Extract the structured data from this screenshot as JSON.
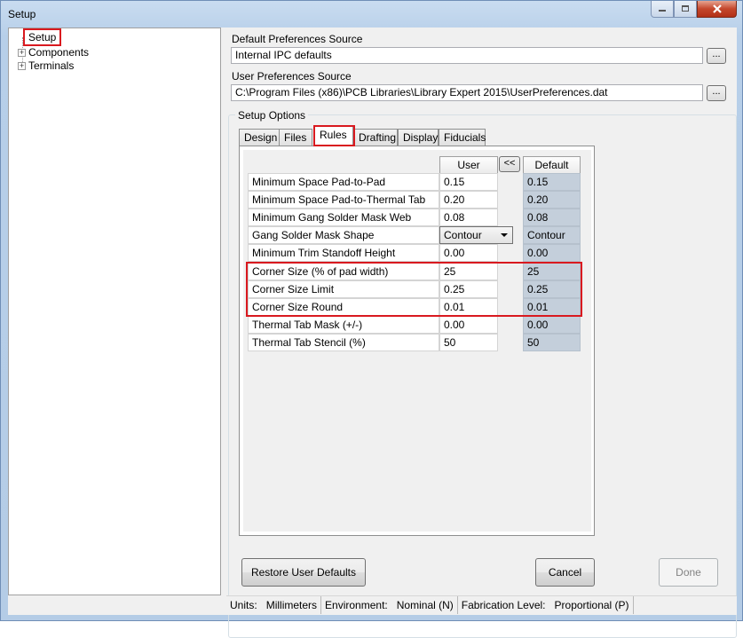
{
  "window": {
    "title": "Setup"
  },
  "tree": {
    "items": [
      {
        "label": "Setup",
        "selected": true,
        "expandable": false
      },
      {
        "label": "Components",
        "expandable": true
      },
      {
        "label": "Terminals",
        "expandable": true
      }
    ]
  },
  "default_prefs": {
    "label": "Default Preferences Source",
    "value": "Internal IPC defaults",
    "browse": "..."
  },
  "user_prefs": {
    "label": "User Preferences Source",
    "value": "C:\\Program Files (x86)\\PCB Libraries\\Library Expert 2015\\UserPreferences.dat",
    "browse": "..."
  },
  "setup_options": {
    "title": "Setup Options",
    "tabs": [
      {
        "label": "Design"
      },
      {
        "label": "Files"
      },
      {
        "label": "Rules",
        "active": true
      },
      {
        "label": "Drafting"
      },
      {
        "label": "Display"
      },
      {
        "label": "Fiducials"
      }
    ]
  },
  "rules": {
    "user_header": "User",
    "default_header": "Default",
    "copy_button": "<<",
    "rows": [
      {
        "name": "Minimum Space Pad-to-Pad",
        "user": "0.15",
        "default": "0.15"
      },
      {
        "name": "Minimum Space Pad-to-Thermal Tab",
        "user": "0.20",
        "default": "0.20"
      },
      {
        "name": "Minimum Gang Solder Mask Web",
        "user": "0.08",
        "default": "0.08"
      },
      {
        "name": "Gang Solder Mask Shape",
        "user": "Contour",
        "default": "Contour"
      },
      {
        "name": "Minimum Trim Standoff Height",
        "user": "0.00",
        "default": "0.00"
      },
      {
        "name": "Corner Size (% of pad width)",
        "user": "25",
        "default": "25"
      },
      {
        "name": "Corner Size Limit",
        "user": "0.25",
        "default": "0.25"
      },
      {
        "name": "Corner Size Round",
        "user": "0.01",
        "default": "0.01"
      },
      {
        "name": "Thermal Tab Mask (+/-)",
        "user": "0.00",
        "default": "0.00"
      },
      {
        "name": "Thermal Tab Stencil (%)",
        "user": "50",
        "default": "50"
      }
    ]
  },
  "buttons": {
    "restore": "Restore User Defaults",
    "cancel": "Cancel",
    "done": "Done"
  },
  "status": {
    "units_label": "Units:",
    "units_value": "Millimeters",
    "env_label": "Environment:",
    "env_value": "Nominal (N)",
    "fab_label": "Fabrication Level:",
    "fab_value": "Proportional (P)"
  },
  "colors": {
    "highlight": "#d9191f",
    "default_cell": "#c4cfdb"
  }
}
